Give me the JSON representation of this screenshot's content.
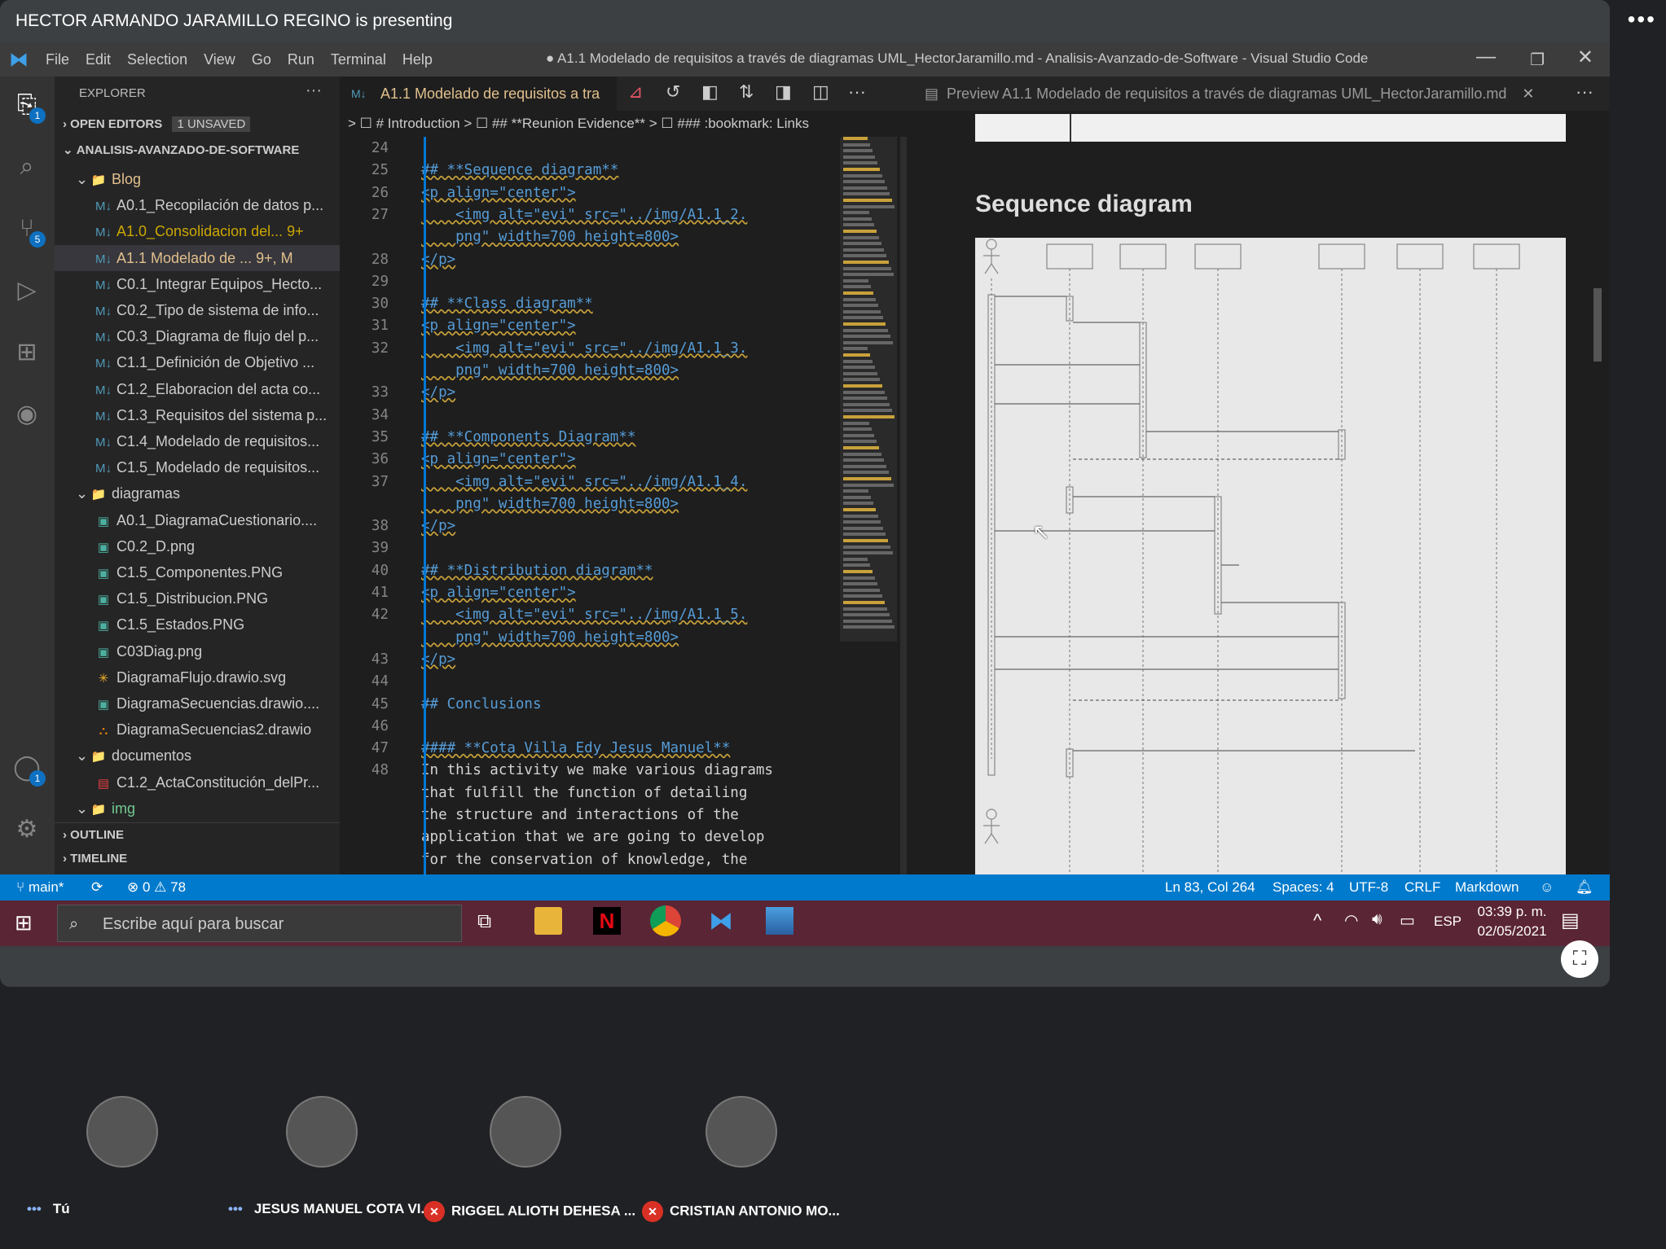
{
  "presenting_label": "HECTOR ARMANDO JARAMILLO REGINO is presenting",
  "menu": [
    "File",
    "Edit",
    "Selection",
    "View",
    "Go",
    "Run",
    "Terminal",
    "Help"
  ],
  "window_title": "● A1.1 Modelado de requisitos a través de diagramas UML_HectorJaramillo.md - Analisis-Avanzado-de-Software - Visual Studio Code",
  "explorer": {
    "title": "EXPLORER",
    "open_editors": "OPEN EDITORS",
    "unsaved": "1 UNSAVED",
    "project": "ANALISIS-AVANZADO-DE-SOFTWARE",
    "outline": "OUTLINE",
    "timeline": "TIMELINE"
  },
  "tree": [
    {
      "label": "Blog",
      "type": "folder",
      "level": 1,
      "color": "#e2c08d"
    },
    {
      "label": "A0.1_Recopilación de datos p...",
      "type": "md",
      "level": 2
    },
    {
      "label": "A1.0_Consolidacion del...  9+",
      "type": "md",
      "level": 2,
      "color": "#cca700"
    },
    {
      "label": "A1.1  Modelado de ...  9+, M",
      "type": "md",
      "level": 2,
      "color": "#e2c08d"
    },
    {
      "label": "C0.1_Integrar Equipos_Hecto...",
      "type": "md",
      "level": 2
    },
    {
      "label": "C0.2_Tipo de sistema de info...",
      "type": "md",
      "level": 2
    },
    {
      "label": "C0.3_Diagrama de flujo del p...",
      "type": "md",
      "level": 2
    },
    {
      "label": "C1.1_Definición de Objetivo ...",
      "type": "md",
      "level": 2
    },
    {
      "label": "C1.2_Elaboracion del acta co...",
      "type": "md",
      "level": 2
    },
    {
      "label": "C1.3_Requisitos del sistema p...",
      "type": "md",
      "level": 2
    },
    {
      "label": "C1.4_Modelado de requisitos...",
      "type": "md",
      "level": 2
    },
    {
      "label": "C1.5_Modelado de requisitos...",
      "type": "md",
      "level": 2
    },
    {
      "label": "diagramas",
      "type": "folder",
      "level": 1
    },
    {
      "label": "A0.1_DiagramaCuestionario....",
      "type": "img",
      "level": 2
    },
    {
      "label": "C0.2_D.png",
      "type": "img",
      "level": 2
    },
    {
      "label": "C1.5_Componentes.PNG",
      "type": "img",
      "level": 2
    },
    {
      "label": "C1.5_Distribucion.PNG",
      "type": "img",
      "level": 2
    },
    {
      "label": "C1.5_Estados.PNG",
      "type": "img",
      "level": 2
    },
    {
      "label": "C03Diag.png",
      "type": "img",
      "level": 2
    },
    {
      "label": "DiagramaFlujo.drawio.svg",
      "type": "svg",
      "level": 2
    },
    {
      "label": "DiagramaSecuencias.drawio....",
      "type": "img",
      "level": 2
    },
    {
      "label": "DiagramaSecuencias2.drawio",
      "type": "drawio",
      "level": 2
    },
    {
      "label": "documentos",
      "type": "folder",
      "level": 1
    },
    {
      "label": "C1.2_ActaConstitución_delPr...",
      "type": "pdf",
      "level": 2
    },
    {
      "label": "img",
      "type": "folder",
      "level": 1,
      "color": "#73c991"
    }
  ],
  "editor_tab": "A1.1  Modelado de requisitos a tra",
  "breadcrumbs": "> ☐ # Introduction > ☐ ## **Reunion Evidence** > ☐ ### :bookmark: Links",
  "code_lines": [
    {
      "n": "24",
      "t": ""
    },
    {
      "n": "25",
      "t": "## **Sequence diagram**",
      "k": "h"
    },
    {
      "n": "26",
      "t": "<p align=\"center\">",
      "k": "tg"
    },
    {
      "n": "27",
      "t": "    <img alt=\"evi\" src=\"../img/A1.1_2.",
      "k": "tg"
    },
    {
      "n": "",
      "t": "    png\" width=700 height=800>",
      "k": "tg"
    },
    {
      "n": "28",
      "t": "</p>",
      "k": "tg"
    },
    {
      "n": "29",
      "t": ""
    },
    {
      "n": "30",
      "t": "## **Class diagram**",
      "k": "h"
    },
    {
      "n": "31",
      "t": "<p align=\"center\">",
      "k": "tg"
    },
    {
      "n": "32",
      "t": "    <img alt=\"evi\" src=\"../img/A1.1_3.",
      "k": "tg"
    },
    {
      "n": "",
      "t": "    png\" width=700 height=800>",
      "k": "tg"
    },
    {
      "n": "33",
      "t": "</p>",
      "k": "tg"
    },
    {
      "n": "34",
      "t": ""
    },
    {
      "n": "35",
      "t": "## **Components Diagram**",
      "k": "h"
    },
    {
      "n": "36",
      "t": "<p align=\"center\">",
      "k": "tg"
    },
    {
      "n": "37",
      "t": "    <img alt=\"evi\" src=\"../img/A1.1_4.",
      "k": "tg"
    },
    {
      "n": "",
      "t": "    png\" width=700 height=800>",
      "k": "tg"
    },
    {
      "n": "38",
      "t": "</p>",
      "k": "tg"
    },
    {
      "n": "39",
      "t": ""
    },
    {
      "n": "40",
      "t": "## **Distribution diagram**",
      "k": "h"
    },
    {
      "n": "41",
      "t": "<p align=\"center\">",
      "k": "tg"
    },
    {
      "n": "42",
      "t": "    <img alt=\"evi\" src=\"../img/A1.1_5.",
      "k": "tg"
    },
    {
      "n": "",
      "t": "    png\" width=700 height=800>",
      "k": "tg"
    },
    {
      "n": "43",
      "t": "</p>",
      "k": "tg"
    },
    {
      "n": "44",
      "t": ""
    },
    {
      "n": "45",
      "t": "## Conclusions",
      "k": "h"
    },
    {
      "n": "46",
      "t": ""
    },
    {
      "n": "47",
      "t": "#### **Cota Villa Edy Jesus Manuel**",
      "k": "h"
    },
    {
      "n": "48",
      "t": "In this activity we make various diagrams",
      "k": "tx"
    },
    {
      "n": "",
      "t": "that fulfill the function of detailing",
      "k": "tx"
    },
    {
      "n": "",
      "t": "the structure and interactions of the",
      "k": "tx"
    },
    {
      "n": "",
      "t": "application that we are going to develop",
      "k": "tx"
    },
    {
      "n": "",
      "t": "for the conservation of knowledge, the",
      "k": "tx"
    }
  ],
  "preview_tab": "Preview A1.1  Modelado de requisitos a través de diagramas UML_HectorJaramillo.md",
  "preview_heading": "Sequence diagram",
  "status": {
    "branch": "main*",
    "problems": "⊗ 0 ⚠ 78",
    "position": "Ln 83, Col 264",
    "spaces": "Spaces: 4",
    "encoding": "UTF-8",
    "eol": "CRLF",
    "language": "Markdown"
  },
  "taskbar": {
    "search_placeholder": "Escribe aquí para buscar",
    "lang": "ESP",
    "time": "03:39 p. m.",
    "date": "02/05/2021"
  },
  "participants": [
    {
      "name": "Tú",
      "muted": false
    },
    {
      "name": "JESUS MANUEL COTA VI...",
      "muted": false
    },
    {
      "name": "RIGGEL ALIOTH DEHESA ...",
      "muted": true
    },
    {
      "name": "CRISTIAN ANTONIO MO...",
      "muted": true
    }
  ]
}
